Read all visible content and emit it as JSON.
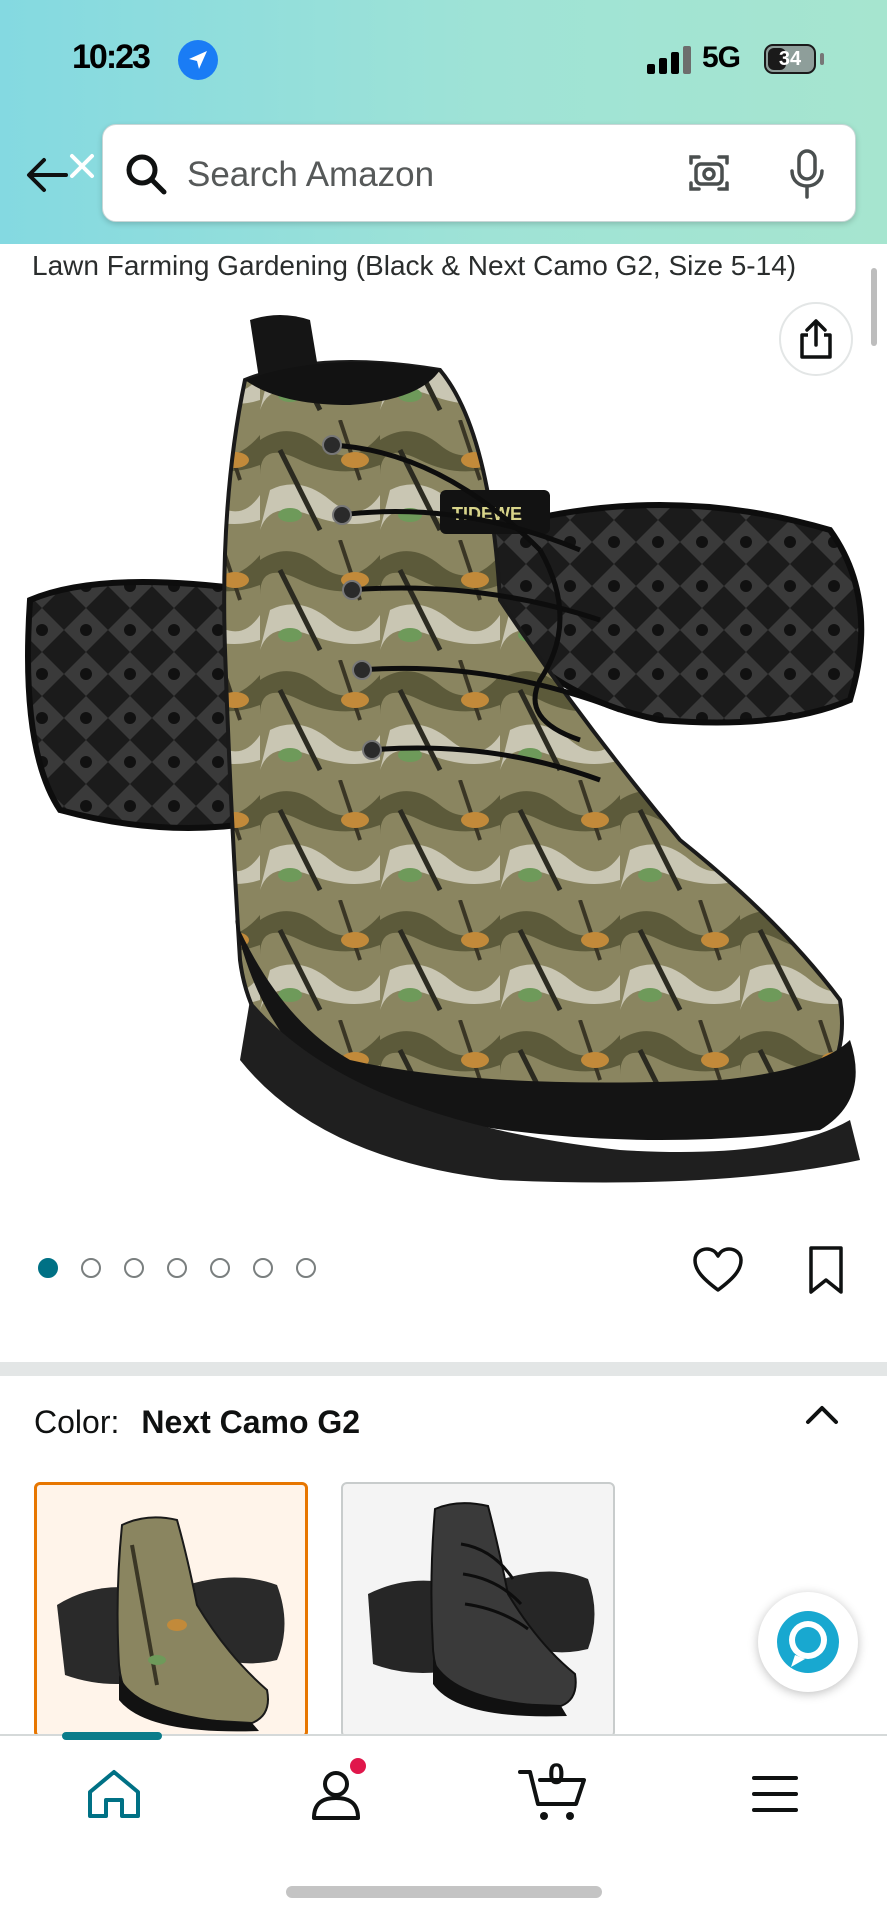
{
  "status_bar": {
    "time": "10:23",
    "network": "5G",
    "battery": "34"
  },
  "search": {
    "placeholder": "Search Amazon"
  },
  "product": {
    "title_tail": "Lawn Farming Gardening (Black & Next Camo G2, Size 5-14)",
    "brand_tag": "TIDEWE",
    "image_count": 7,
    "active_image_index": 0
  },
  "color": {
    "label": "Color:",
    "selected": "Next Camo G2",
    "options": [
      "Next Camo G2",
      "Black"
    ]
  },
  "nav": {
    "cart_count": "0"
  },
  "colors": {
    "accent_teal": "#007185",
    "selected_orange": "#e77600",
    "header_gradient_start": "#84d9e1",
    "header_gradient_end": "#a6e5cf",
    "notification_dot": "#e0174b"
  },
  "icons": [
    "back-arrow-icon",
    "search-icon",
    "camera-icon",
    "mic-icon",
    "share-icon",
    "heart-icon",
    "bookmark-icon",
    "chevron-up-icon",
    "alexa-icon",
    "home-icon",
    "account-icon",
    "cart-icon",
    "menu-icon"
  ]
}
